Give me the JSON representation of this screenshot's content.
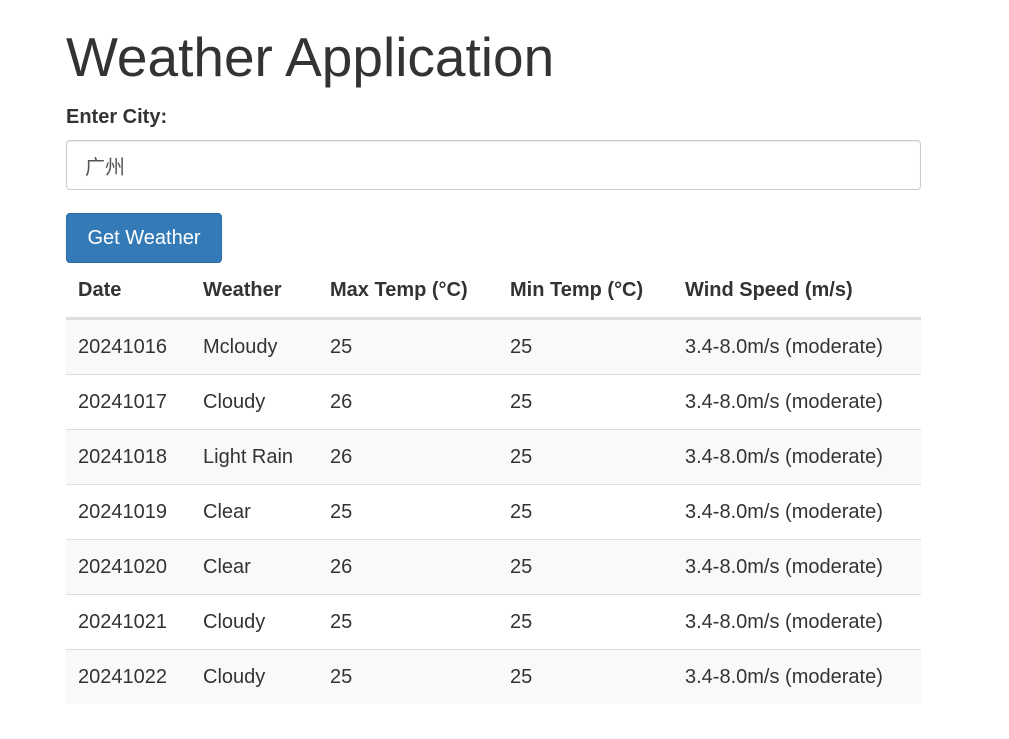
{
  "page": {
    "title": "Weather Application"
  },
  "form": {
    "city_label": "Enter City:",
    "city_value": "广州",
    "submit_label": "Get Weather"
  },
  "table": {
    "headers": [
      "Date",
      "Weather",
      "Max Temp (°C)",
      "Min Temp (°C)",
      "Wind Speed (m/s)"
    ],
    "rows": [
      [
        "20241016",
        "Mcloudy",
        "25",
        "25",
        "3.4-8.0m/s (moderate)"
      ],
      [
        "20241017",
        "Cloudy",
        "26",
        "25",
        "3.4-8.0m/s (moderate)"
      ],
      [
        "20241018",
        "Light Rain",
        "26",
        "25",
        "3.4-8.0m/s (moderate)"
      ],
      [
        "20241019",
        "Clear",
        "25",
        "25",
        "3.4-8.0m/s (moderate)"
      ],
      [
        "20241020",
        "Clear",
        "26",
        "25",
        "3.4-8.0m/s (moderate)"
      ],
      [
        "20241021",
        "Cloudy",
        "25",
        "25",
        "3.4-8.0m/s (moderate)"
      ],
      [
        "20241022",
        "Cloudy",
        "25",
        "25",
        "3.4-8.0m/s (moderate)"
      ]
    ]
  },
  "colors": {
    "button_primary": "#337ab7",
    "text": "#333333",
    "row_stripe": "#f9f9f9",
    "border": "#dddddd"
  }
}
